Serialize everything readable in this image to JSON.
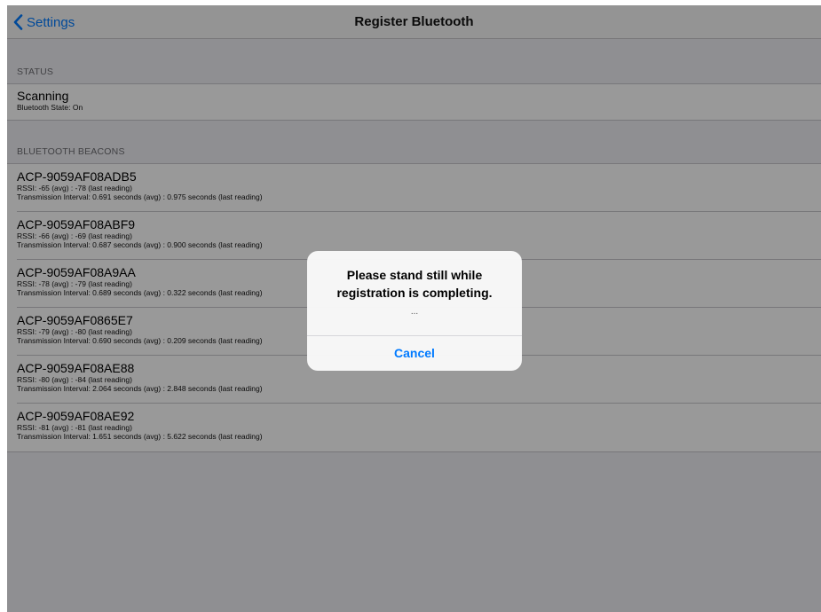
{
  "navbar": {
    "back_label": "Settings",
    "title": "Register Bluetooth"
  },
  "status_section": {
    "header": "STATUS",
    "title": "Scanning",
    "subtitle": "Bluetooth State: On"
  },
  "beacons_section": {
    "header": "BLUETOOTH BEACONS",
    "items": [
      {
        "name": "ACP-9059AF08ADB5",
        "rssi": "RSSI: -65 (avg) : -78 (last reading)",
        "interval": "Transmission Interval: 0.691 seconds (avg) : 0.975 seconds (last reading)"
      },
      {
        "name": "ACP-9059AF08ABF9",
        "rssi": "RSSI: -66 (avg) : -69 (last reading)",
        "interval": "Transmission Interval: 0.687 seconds (avg) : 0.900 seconds (last reading)"
      },
      {
        "name": "ACP-9059AF08A9AA",
        "rssi": "RSSI: -78 (avg) : -79 (last reading)",
        "interval": "Transmission Interval: 0.689 seconds (avg) : 0.322 seconds (last reading)"
      },
      {
        "name": "ACP-9059AF0865E7",
        "rssi": "RSSI: -79 (avg) : -80 (last reading)",
        "interval": "Transmission Interval: 0.690 seconds (avg) : 0.209 seconds (last reading)"
      },
      {
        "name": "ACP-9059AF08AE88",
        "rssi": "RSSI: -80 (avg) : -84 (last reading)",
        "interval": "Transmission Interval: 2.064 seconds (avg) : 2.848 seconds (last reading)"
      },
      {
        "name": "ACP-9059AF08AE92",
        "rssi": "RSSI: -81 (avg) : -81 (last reading)",
        "interval": "Transmission Interval: 1.651 seconds (avg) : 5.622 seconds (last reading)"
      }
    ]
  },
  "alert": {
    "title": "Please stand still while registration is completing.",
    "message": "...",
    "cancel_label": "Cancel"
  },
  "colors": {
    "accent": "#007aff",
    "background": "#efeff4",
    "separator": "#c8c7cc"
  },
  "icons": {
    "back": "chevron-left-icon"
  }
}
